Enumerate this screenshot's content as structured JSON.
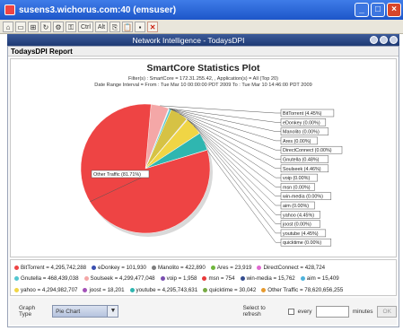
{
  "window": {
    "title": "susens3.wichorus.com:40 (emsuser)"
  },
  "toolbar": {
    "ctrl_label": "Ctrl",
    "alt_label": "Alt"
  },
  "inner_window": {
    "title": "Network Intelligence - TodaysDPI"
  },
  "report": {
    "header": "TodaysDPI Report",
    "chart_title": "SmartCore Statistics Plot",
    "filters_line": "Filter(s) : SmartCore = 172.31.255.42, , Application(s) = All (Top 20)",
    "date_line": "Date Range Interval = From : Tue Mar 10 00:00:00 PDT 2009 To : Tue Mar 10 14:46:00 PDT 2009"
  },
  "chart_data": {
    "type": "pie",
    "title": "SmartCore Statistics Plot",
    "slices": [
      {
        "name": "BitTorrent",
        "value": 4295742288,
        "label": "BitTorrent (4.45%)",
        "color": "#f4a7a7"
      },
      {
        "name": "eDonkey",
        "value": 101930,
        "label": "eDonkey (0.00%)",
        "color": "#3a4fb0"
      },
      {
        "name": "Manolito",
        "value": 422890,
        "label": "Manolito (0.00%)",
        "color": "#7d7d7d"
      },
      {
        "name": "Ares",
        "value": 23919,
        "label": "Ares (0.00%)",
        "color": "#6fb63c"
      },
      {
        "name": "DirectConnect",
        "value": 428724,
        "label": "DirectConnect (0.00%)",
        "color": "#e069d0"
      },
      {
        "name": "Gnutella",
        "value": 468439038,
        "label": "Gnutella (0.48%)",
        "color": "#52c6cf"
      },
      {
        "name": "Soulseek",
        "value": 4299477048,
        "label": "Soulseek (4.46%)",
        "color": "#d6c244"
      },
      {
        "name": "voip",
        "value": 1958,
        "label": "voip (0.00%)",
        "color": "#7a4fb0"
      },
      {
        "name": "msn",
        "value": 754,
        "label": "msn (0.00%)",
        "color": "#e83a3a"
      },
      {
        "name": "win-media",
        "value": 15762,
        "label": "win-media (0.00%)",
        "color": "#354d8e"
      },
      {
        "name": "aim",
        "value": 15409,
        "label": "aim (0.00%)",
        "color": "#4fb3dc"
      },
      {
        "name": "yahoo",
        "value": 4294982707,
        "label": "yahoo (4.45%)",
        "color": "#f0d545"
      },
      {
        "name": "joost",
        "value": 18201,
        "label": "joost (0.00%)",
        "color": "#a352b8"
      },
      {
        "name": "youtube",
        "value": 4295743631,
        "label": "youtube (4.45%)",
        "color": "#2fb6b0"
      },
      {
        "name": "quicktime",
        "value": 30042,
        "label": "quicktime (0.00%)",
        "color": "#77aa44"
      },
      {
        "name": "Other Traffic",
        "value": 78620656255,
        "label": "Other Traffic (81.71%)",
        "color": "#ee4444"
      }
    ],
    "label_order": [
      "BitTorrent",
      "eDonkey",
      "Manolito",
      "Ares",
      "DirectConnect",
      "Gnutella",
      "Soulseek",
      "voip",
      "msn",
      "win-media",
      "aim",
      "yahoo",
      "joost",
      "youtube",
      "quicktime"
    ]
  },
  "legend": {
    "rows": [
      [
        {
          "text": "BitTorrent = 4,295,742,288",
          "color": "#ee4444"
        },
        {
          "text": "eDonkey = 101,930",
          "color": "#3a4fb0"
        },
        {
          "text": "Manolito = 422,890",
          "color": "#7d7d7d"
        },
        {
          "text": "Ares = 23,919",
          "color": "#6fb63c"
        },
        {
          "text": "DirectConnect = 428,724",
          "color": "#e069d0"
        }
      ],
      [
        {
          "text": "Gnutella = 468,439,038",
          "color": "#52c6cf"
        },
        {
          "text": "Soulseek = 4,299,477,048",
          "color": "#f4a7a7"
        },
        {
          "text": "voip = 1,958",
          "color": "#7a4fb0"
        },
        {
          "text": "msn = 754",
          "color": "#e83a3a"
        },
        {
          "text": "win-media = 15,762",
          "color": "#354d8e"
        },
        {
          "text": "aim = 15,409",
          "color": "#4fb3dc"
        }
      ],
      [
        {
          "text": "yahoo = 4,294,982,707",
          "color": "#f0d545"
        },
        {
          "text": "joost = 18,201",
          "color": "#a352b8"
        },
        {
          "text": "youtube = 4,295,743,631",
          "color": "#2fb6b0"
        },
        {
          "text": "quicktime = 30,042",
          "color": "#77aa44"
        },
        {
          "text": "Other Traffic = 78,620,656,255",
          "color": "#e69a2e"
        }
      ]
    ]
  },
  "controls": {
    "graph_type_label": "Graph Type",
    "graph_type_value": "Pie Chart",
    "refresh_label": "Select to refresh",
    "every_label": "every",
    "minutes_label": "minutes",
    "ok_label": "OK"
  }
}
